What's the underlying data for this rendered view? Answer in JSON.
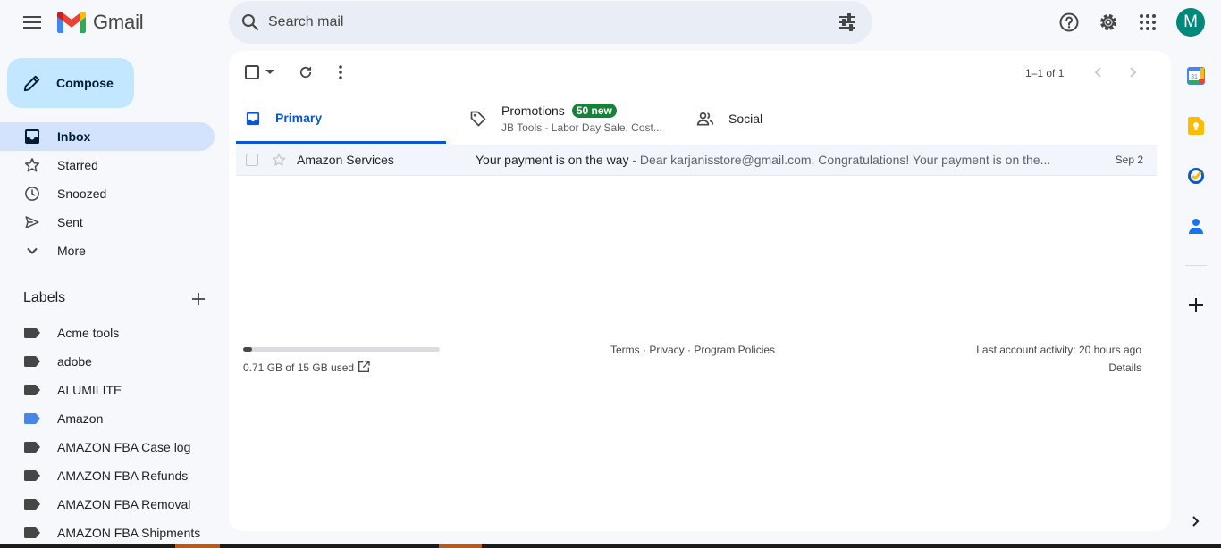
{
  "app": {
    "name": "Gmail"
  },
  "search": {
    "placeholder": "Search mail"
  },
  "account": {
    "avatar_letter": "M",
    "avatar_color": "#00897b"
  },
  "compose": {
    "label": "Compose"
  },
  "nav": [
    {
      "label": "Inbox",
      "icon": "inbox-icon",
      "active": true
    },
    {
      "label": "Starred",
      "icon": "star-icon"
    },
    {
      "label": "Snoozed",
      "icon": "clock-icon"
    },
    {
      "label": "Sent",
      "icon": "send-icon"
    },
    {
      "label": "More",
      "icon": "chevron-down-icon"
    }
  ],
  "labels": {
    "title": "Labels",
    "items": [
      {
        "name": "Acme tools",
        "color": "#444746"
      },
      {
        "name": "adobe",
        "color": "#444746"
      },
      {
        "name": "ALUMILITE",
        "color": "#444746"
      },
      {
        "name": "Amazon",
        "color": "#4a86e8"
      },
      {
        "name": "AMAZON FBA Case log",
        "color": "#444746"
      },
      {
        "name": "AMAZON FBA Refunds",
        "color": "#444746"
      },
      {
        "name": "AMAZON FBA Removal",
        "color": "#444746"
      },
      {
        "name": "AMAZON FBA Shipments",
        "color": "#444746"
      }
    ]
  },
  "toolbar": {
    "pager": "1–1 of 1"
  },
  "tabs": {
    "primary": {
      "label": "Primary"
    },
    "promotions": {
      "label": "Promotions",
      "badge": "50 new",
      "subtitle": "JB Tools - Labor Day Sale, Cost..."
    },
    "social": {
      "label": "Social"
    }
  },
  "emails": [
    {
      "sender": "Amazon Services",
      "subject": "Your payment is on the way",
      "snippet": " - Dear karjanisstore@gmail.com, Congratulations! Your payment is on the...",
      "date": "Sep 2"
    }
  ],
  "footer": {
    "storage_text": "0.71 GB of 15 GB used",
    "storage_fraction": 0.047,
    "links": "Terms · Privacy · Program Policies",
    "activity": "Last account activity: 20 hours ago",
    "details": "Details"
  },
  "colors": {
    "accent": "#0b57d0",
    "compose_bg": "#c2e7ff",
    "active_nav_bg": "#d3e3fd",
    "promo_badge": "#188038"
  }
}
